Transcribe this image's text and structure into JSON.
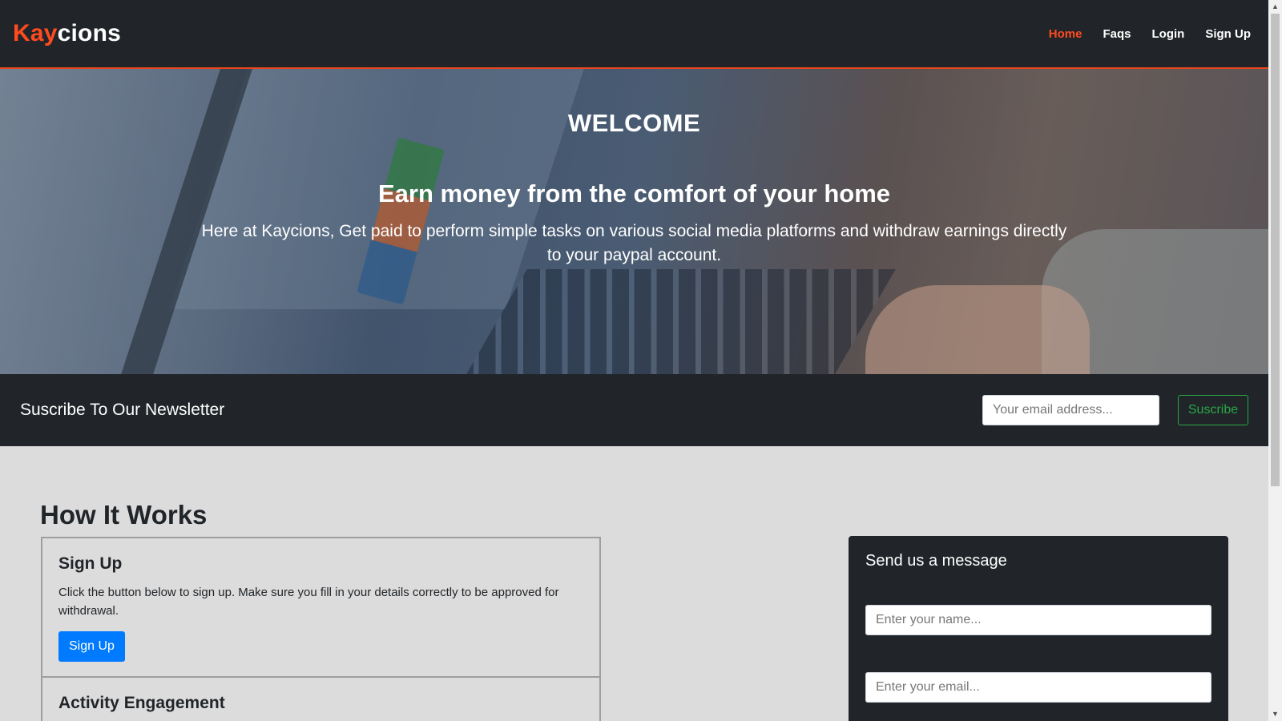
{
  "navbar": {
    "brand_accent": "Kay",
    "brand_rest": "cions",
    "links": [
      {
        "label": "Home",
        "active": true
      },
      {
        "label": "Faqs",
        "active": false
      },
      {
        "label": "Login",
        "active": false
      },
      {
        "label": "Sign Up",
        "active": false
      }
    ]
  },
  "hero": {
    "welcome": "WELCOME",
    "tagline": "Earn money from the comfort of your home",
    "description": "Here at Kaycions, Get paid to perform simple tasks on various social media platforms and withdraw earnings directly to your paypal account."
  },
  "newsletter": {
    "title": "Suscribe To Our Newsletter",
    "email_placeholder": "Your email address...",
    "button_label": "Suscribe"
  },
  "how_it_works": {
    "title": "How It Works",
    "steps": [
      {
        "title": "Sign Up",
        "description": "Click the button below to sign up. Make sure you fill in your details correctly to be approved for withdrawal.",
        "button_label": "Sign Up"
      },
      {
        "title": "Activity Engagement"
      }
    ]
  },
  "contact": {
    "title": "Send us a message",
    "name_placeholder": "Enter your name...",
    "email_placeholder": "Enter your email..."
  },
  "colors": {
    "accent": "#ff4b1f",
    "dark": "#212529",
    "primary": "#007bff",
    "success": "#28a745"
  }
}
